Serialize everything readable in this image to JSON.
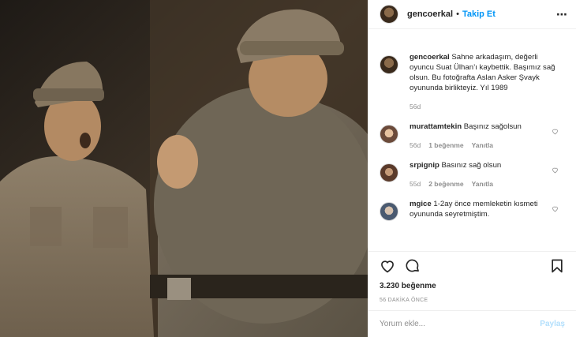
{
  "post": {
    "username": "gencoerkal",
    "follow_label": "Takip Et",
    "caption_user": "gencoerkal",
    "caption_text": "Sahne arkadaşım, değerli oyuncu Suat Ülhan’ı kaybettik. Başımız sağ olsun. Bu fotoğrafta Aslan Asker Şvayk oyununda birlikteyiz. Yıl 1989",
    "caption_age": "56d",
    "likes": "3.230 beğenme",
    "timestamp": "56 DAKİKA ÖNCE"
  },
  "comments": [
    {
      "user": "murattamtekin",
      "text": "Başınız sağolsun",
      "age": "56d",
      "likes": "1 beğenme",
      "reply": "Yanıtla"
    },
    {
      "user": "srpignip",
      "text": "Basınız sağ olsun",
      "age": "55d",
      "likes": "2 beğenme",
      "reply": "Yanıtla"
    },
    {
      "user": "mgice",
      "text": "1-2ay önce memleketin kısmeti oyununda seyretmiştim.",
      "age": "",
      "likes": "",
      "reply": ""
    }
  ],
  "comment_input": {
    "placeholder": "Yorum ekle...",
    "submit_label": "Paylaş"
  },
  "icons": {
    "header_more": "more-options-icon",
    "like": "heart-icon",
    "comment": "comment-icon",
    "save": "bookmark-icon"
  },
  "colors": {
    "link_blue": "#0095f6",
    "muted": "#8e8e8e",
    "share_disabled": "#b2dffc"
  }
}
